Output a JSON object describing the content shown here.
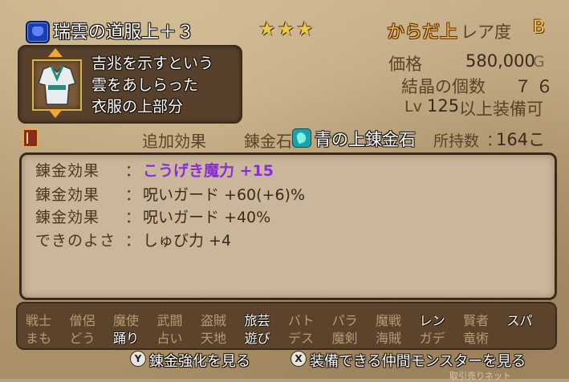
{
  "header": {
    "icon": "armor-body-icon",
    "item_name": "瑞雲の道服上＋３",
    "stars": "★★★",
    "slot": "からだ上",
    "rarity_label": "レア度",
    "rarity_value": "B"
  },
  "description": {
    "lines": [
      "吉兆を示すという",
      "雲をあしらった",
      "衣服の上部分"
    ]
  },
  "stats": {
    "price_label": "価格",
    "price_value": "580,000",
    "price_unit": "G",
    "crystal_label": "結晶の個数",
    "crystal_value": "７６",
    "level_prefix": "Lv",
    "level_value": "125",
    "level_suffix": "以上装備可"
  },
  "alchemy": {
    "extra_effect_label": "追加効果",
    "stone_label": "錬金石",
    "stone_name": "青の上錬金石",
    "owned_label": "所持数",
    "owned_colon": "：",
    "owned_value": "164こ"
  },
  "effects": [
    {
      "label": "錬金効果",
      "colon": "：",
      "value": "こうげき魔力 +15"
    },
    {
      "label": "錬金効果",
      "colon": "：",
      "value": "呪いガード +60(+6)%"
    },
    {
      "label": "錬金効果",
      "colon": "：",
      "value": "呪いガード +40%"
    },
    {
      "label": "できのよさ",
      "colon": "：",
      "value": "しゅび力 +4"
    }
  ],
  "jobs_row1": [
    {
      "name": "戦士",
      "on": false
    },
    {
      "name": "僧侶",
      "on": false
    },
    {
      "name": "魔使",
      "on": false
    },
    {
      "name": "武闘",
      "on": false
    },
    {
      "name": "盗賊",
      "on": false
    },
    {
      "name": "旅芸",
      "on": true
    },
    {
      "name": "バト",
      "on": false
    },
    {
      "name": "パラ",
      "on": false
    },
    {
      "name": "魔戦",
      "on": false
    },
    {
      "name": "レン",
      "on": true
    },
    {
      "name": "賢者",
      "on": false
    },
    {
      "name": "スパ",
      "on": true
    }
  ],
  "jobs_row2": [
    {
      "name": "まも",
      "on": false
    },
    {
      "name": "どう",
      "on": false
    },
    {
      "name": "踊り",
      "on": true
    },
    {
      "name": "占い",
      "on": false
    },
    {
      "name": "天地",
      "on": false
    },
    {
      "name": "遊び",
      "on": true
    },
    {
      "name": "デス",
      "on": false
    },
    {
      "name": "魔剣",
      "on": false
    },
    {
      "name": "海賊",
      "on": false
    },
    {
      "name": "ガデ",
      "on": false
    },
    {
      "name": "竜術",
      "on": false
    }
  ],
  "hints": {
    "y_button": "Y",
    "y_text": "錬金強化を見る",
    "x_button": "X",
    "x_text": "装備できる仲間モンスターを見る"
  },
  "watermark": "取引売りネット"
}
